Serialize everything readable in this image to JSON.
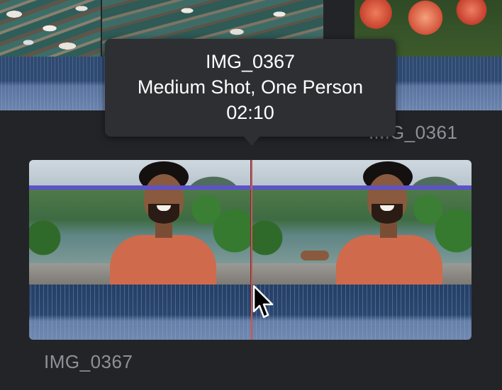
{
  "tooltip": {
    "clip_name": "IMG_0367",
    "shot_type": "Medium Shot, One Person",
    "duration": "02:10"
  },
  "clips": {
    "top_right_label": "IMG_0361",
    "main_label": "IMG_0367"
  },
  "colors": {
    "playhead": "#e0503a",
    "keyword_bar": "#5d52c9",
    "audio_waveform": "#2b476f",
    "background": "#232427"
  },
  "icons": {
    "pointer": "arrow-cursor-icon"
  }
}
